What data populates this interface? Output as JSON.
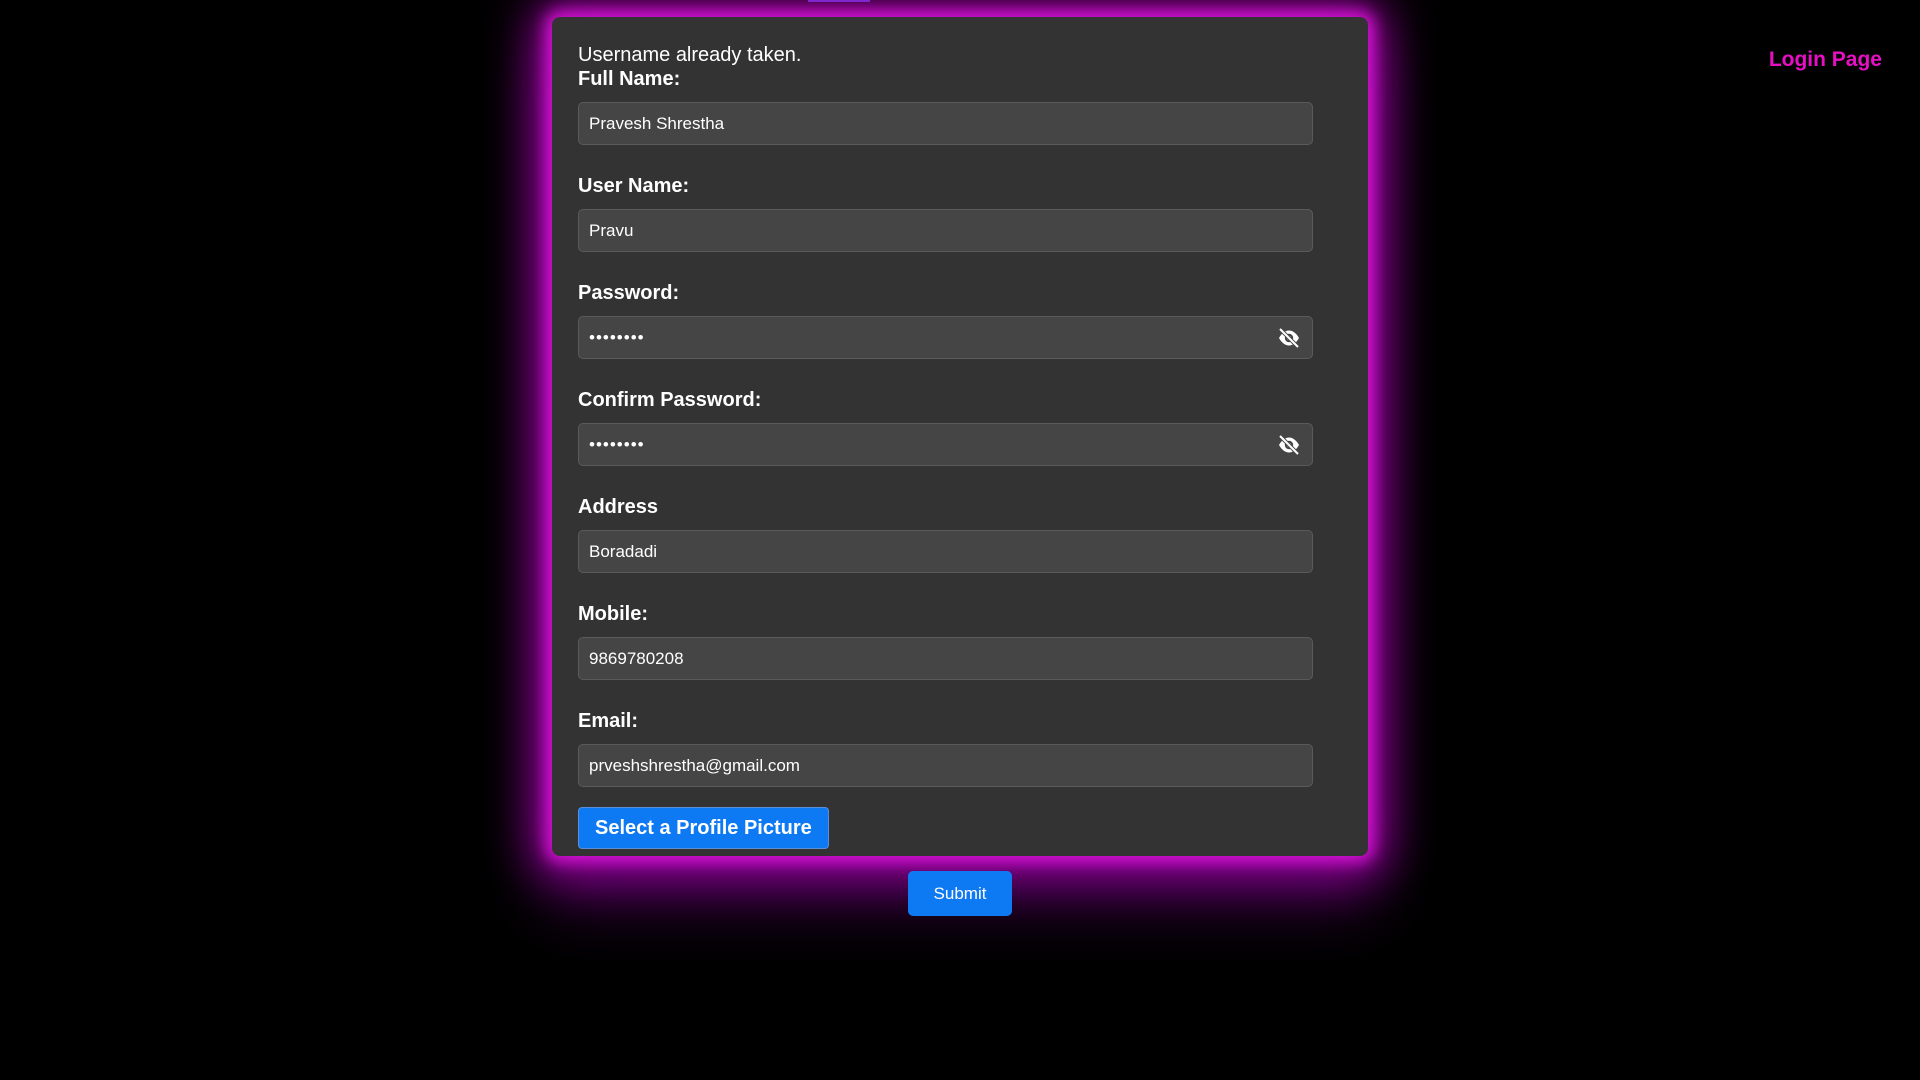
{
  "top_nav": {
    "login_link": "Login Page"
  },
  "form": {
    "error_message": "Username already taken.",
    "fields": {
      "full_name": {
        "label": "Full Name:",
        "value": "Pravesh Shrestha"
      },
      "user_name": {
        "label": "User Name:",
        "value": "Pravu"
      },
      "password": {
        "label": "Password:",
        "value": "••••••••",
        "icon": "eye-slash-icon"
      },
      "confirm_password": {
        "label": "Confirm Password:",
        "value": "••••••••",
        "icon": "eye-slash-icon"
      },
      "address": {
        "label": "Address",
        "value": "Boradadi"
      },
      "mobile": {
        "label": "Mobile:",
        "value": "9869780208"
      },
      "email": {
        "label": "Email:",
        "value": "prveshshrestha@gmail.com"
      }
    },
    "profile_picture_button": "Select a Profile Picture",
    "submit_label": "Submit"
  },
  "colors": {
    "background": "#000000",
    "card": "#333333",
    "glow": "#d613d6",
    "link": "#e60fc4",
    "button": "#0d79f2"
  }
}
